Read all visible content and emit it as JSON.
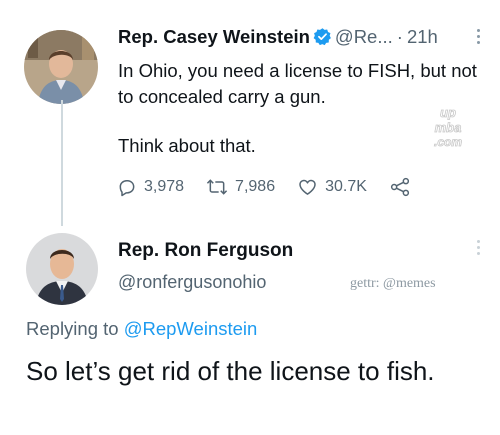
{
  "tweet": {
    "author_name": "Rep. Casey Weinstein",
    "author_handle": "@Re...",
    "separator": "·",
    "time": "21h",
    "text": "In Ohio, you need a license to FISH, but not to concealed carry a gun.",
    "text2": "Think about that.",
    "replies": "3,978",
    "retweets": "7,986",
    "likes": "30.7K",
    "icons": [
      "verified-badge-icon",
      "reply-icon",
      "retweet-icon",
      "like-icon",
      "share-icon",
      "more-icon"
    ],
    "colors": {
      "verified": "#1d9bf0",
      "secondary_text": "#536471"
    }
  },
  "reply": {
    "author_name": "Rep. Ron Ferguson",
    "author_handle": "@ronfergusonohio",
    "replying_label": "Replying to",
    "replying_to": "@RepWeinstein",
    "text": "So let’s get rid of the license to fish."
  },
  "overlay": {
    "gettr_tag": "gettr: @memes",
    "watermark_logo_text": "up mba .com"
  }
}
